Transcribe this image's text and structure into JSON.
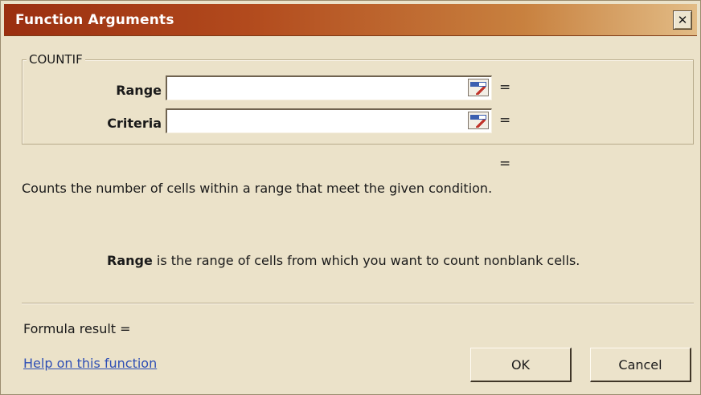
{
  "window": {
    "title": "Function Arguments",
    "close_glyph": "✕"
  },
  "group": {
    "legend": "COUNTIF"
  },
  "arguments": [
    {
      "label": "Range",
      "value": "",
      "equals": "="
    },
    {
      "label": "Criteria",
      "value": "",
      "equals": "="
    }
  ],
  "result_equals": "=",
  "description": "Counts the number of cells within a range that meet the given condition.",
  "arg_help": {
    "name": "Range",
    "text": " is the range of cells from which you want to count nonblank cells."
  },
  "formula_result": {
    "label": "Formula result ="
  },
  "links": {
    "help": "Help on this function"
  },
  "buttons": {
    "ok": "OK",
    "cancel": "Cancel"
  },
  "icons": {
    "close": "close-icon",
    "ref_collapse": "collapse-dialog-icon"
  },
  "colors": {
    "title_bar_start": "#9a2f10",
    "title_bar_end": "#e2bc86",
    "dialog_bg": "#ebe2c9",
    "link": "#2f4fb5"
  }
}
